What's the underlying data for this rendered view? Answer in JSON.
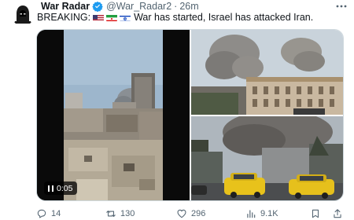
{
  "tweet": {
    "author_name": "War Radar",
    "handle": "@War_Radar2",
    "separator": "·",
    "time": "26m",
    "text_prefix": "BREAKING:",
    "text_body": "War has started, Israel has attacked Iran.",
    "flags": [
      "us-flag-icon",
      "iran-flag-icon",
      "israel-flag-icon"
    ]
  },
  "media": {
    "video_timestamp": "0:05"
  },
  "actions": {
    "replies": "14",
    "reposts": "130",
    "likes": "296",
    "views": "9.1K"
  },
  "colors": {
    "text": "#0f1419",
    "secondary": "#536471",
    "verified": "#1d9bf0"
  }
}
